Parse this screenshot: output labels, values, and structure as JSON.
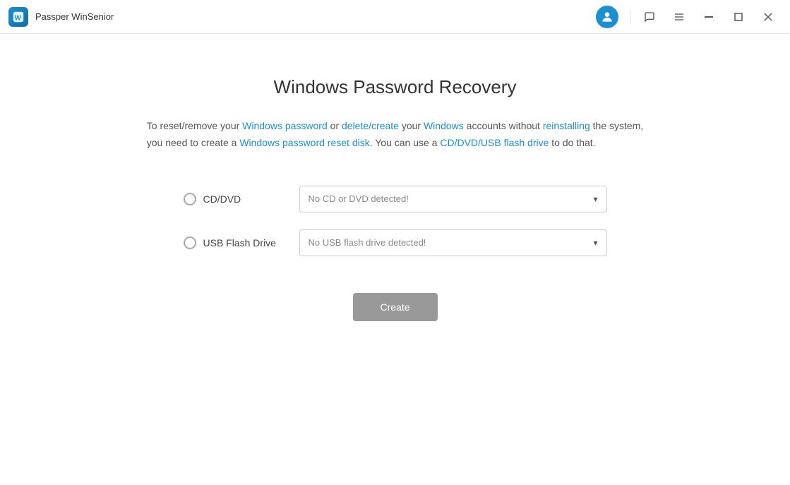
{
  "titleBar": {
    "appName": "Passper WinSenior",
    "minimizeLabel": "−",
    "maximizeLabel": "❐",
    "closeLabel": "✕",
    "menuLabel": "☰",
    "chatLabel": "💬"
  },
  "page": {
    "title": "Windows Password Recovery",
    "description": {
      "line1_prefix": "To reset/remove your ",
      "line1_highlight1": "Windows password",
      "line1_mid1": " or ",
      "line1_highlight2": "delete/create",
      "line1_mid2": " your ",
      "line1_highlight3": "Windows",
      "line1_mid3": " accounts without ",
      "line1_highlight4": "reinstalling",
      "line1_suffix": " the system,",
      "line2_prefix": "you need to create a ",
      "line2_highlight1": "Windows password reset disk",
      "line2_mid": ". You can use a ",
      "line2_highlight2": "CD/DVD/USB flash drive",
      "line2_suffix": " to do that."
    }
  },
  "options": {
    "cdDvd": {
      "label": "CD/DVD",
      "placeholder": "No CD or DVD detected!"
    },
    "usbFlashDrive": {
      "label": "USB Flash Drive",
      "placeholder": "No USB flash drive detected!"
    }
  },
  "buttons": {
    "create": "Create"
  }
}
